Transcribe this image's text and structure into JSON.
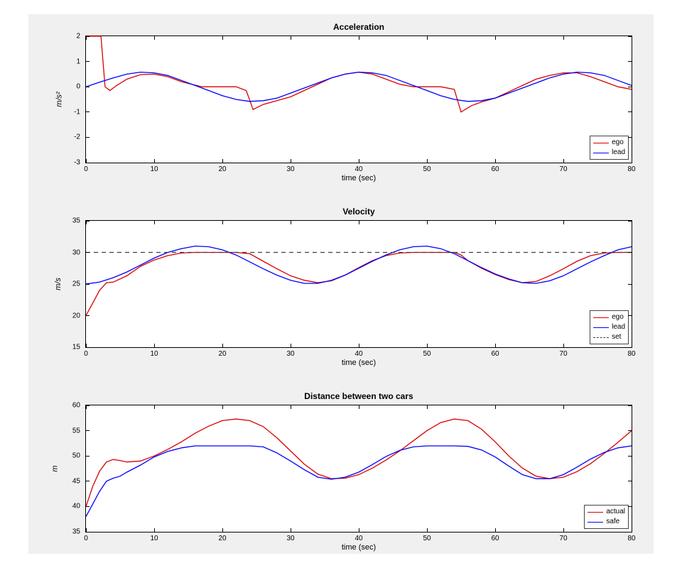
{
  "figure": {
    "bg": "#f0f0f0"
  },
  "colors": {
    "ego": "#d90000",
    "lead": "#0000ff",
    "set": "#404040",
    "actual": "#d90000",
    "safe": "#0000ff"
  },
  "chart_data": [
    {
      "id": "accel",
      "type": "line",
      "title": "Acceleration",
      "xlabel": "time (sec)",
      "ylabel": "m/s²",
      "xlim": [
        0,
        80
      ],
      "ylim": [
        -3,
        2
      ],
      "xticks": [
        0,
        10,
        20,
        30,
        40,
        50,
        60,
        70,
        80
      ],
      "yticks": [
        -3,
        -2,
        -1,
        0,
        1,
        2
      ],
      "legend_pos": "bottom-right",
      "series": [
        {
          "name": "ego",
          "color_key": "ego",
          "points": [
            [
              0,
              2
            ],
            [
              2.2,
              2
            ],
            [
              2.8,
              0
            ],
            [
              3.5,
              -0.15
            ],
            [
              4.5,
              0.05
            ],
            [
              6,
              0.3
            ],
            [
              8,
              0.48
            ],
            [
              10,
              0.5
            ],
            [
              12,
              0.4
            ],
            [
              14,
              0.2
            ],
            [
              17,
              0
            ],
            [
              20,
              0
            ],
            [
              22,
              0
            ],
            [
              23.5,
              -0.15
            ],
            [
              24.5,
              -0.9
            ],
            [
              26,
              -0.7
            ],
            [
              28,
              -0.55
            ],
            [
              30,
              -0.4
            ],
            [
              32,
              -0.15
            ],
            [
              34,
              0.1
            ],
            [
              36,
              0.35
            ],
            [
              38,
              0.5
            ],
            [
              40,
              0.58
            ],
            [
              42,
              0.5
            ],
            [
              44,
              0.3
            ],
            [
              46,
              0.1
            ],
            [
              48,
              0
            ],
            [
              50,
              0
            ],
            [
              52,
              0
            ],
            [
              54,
              -0.1
            ],
            [
              55,
              -1.0
            ],
            [
              56.5,
              -0.75
            ],
            [
              58,
              -0.6
            ],
            [
              60,
              -0.45
            ],
            [
              62,
              -0.2
            ],
            [
              64,
              0.05
            ],
            [
              66,
              0.3
            ],
            [
              68,
              0.45
            ],
            [
              70,
              0.55
            ],
            [
              72,
              0.55
            ],
            [
              74,
              0.4
            ],
            [
              76,
              0.2
            ],
            [
              78,
              0
            ],
            [
              80,
              -0.1
            ]
          ]
        },
        {
          "name": "lead",
          "color_key": "lead",
          "points": [
            [
              0,
              0
            ],
            [
              2,
              0.18
            ],
            [
              4,
              0.35
            ],
            [
              6,
              0.5
            ],
            [
              8,
              0.58
            ],
            [
              10,
              0.55
            ],
            [
              12,
              0.45
            ],
            [
              14,
              0.25
            ],
            [
              16,
              0.05
            ],
            [
              18,
              -0.15
            ],
            [
              20,
              -0.35
            ],
            [
              22,
              -0.5
            ],
            [
              24,
              -0.58
            ],
            [
              26,
              -0.55
            ],
            [
              28,
              -0.45
            ],
            [
              30,
              -0.25
            ],
            [
              32,
              -0.05
            ],
            [
              34,
              0.15
            ],
            [
              36,
              0.35
            ],
            [
              38,
              0.5
            ],
            [
              40,
              0.58
            ],
            [
              42,
              0.55
            ],
            [
              44,
              0.45
            ],
            [
              46,
              0.25
            ],
            [
              48,
              0.05
            ],
            [
              50,
              -0.15
            ],
            [
              52,
              -0.35
            ],
            [
              54,
              -0.5
            ],
            [
              56,
              -0.58
            ],
            [
              58,
              -0.55
            ],
            [
              60,
              -0.45
            ],
            [
              62,
              -0.25
            ],
            [
              64,
              -0.05
            ],
            [
              66,
              0.15
            ],
            [
              68,
              0.35
            ],
            [
              70,
              0.5
            ],
            [
              72,
              0.58
            ],
            [
              74,
              0.55
            ],
            [
              76,
              0.45
            ],
            [
              78,
              0.25
            ],
            [
              80,
              0.05
            ]
          ]
        }
      ]
    },
    {
      "id": "vel",
      "type": "line",
      "title": "Velocity",
      "xlabel": "time (sec)",
      "ylabel": "m/s",
      "xlim": [
        0,
        80
      ],
      "ylim": [
        15,
        35
      ],
      "xticks": [
        0,
        10,
        20,
        30,
        40,
        50,
        60,
        70,
        80
      ],
      "yticks": [
        15,
        20,
        25,
        30,
        35
      ],
      "legend_pos": "bottom-right",
      "series": [
        {
          "name": "ego",
          "color_key": "ego",
          "points": [
            [
              0,
              20
            ],
            [
              1,
              22
            ],
            [
              2,
              24
            ],
            [
              3,
              25.2
            ],
            [
              4,
              25.3
            ],
            [
              5,
              25.8
            ],
            [
              6,
              26.3
            ],
            [
              8,
              27.8
            ],
            [
              10,
              28.8
            ],
            [
              12,
              29.5
            ],
            [
              14,
              29.9
            ],
            [
              16,
              30
            ],
            [
              18,
              30
            ],
            [
              20,
              30
            ],
            [
              22,
              30
            ],
            [
              24,
              29.8
            ],
            [
              26,
              28.6
            ],
            [
              28,
              27.4
            ],
            [
              30,
              26.3
            ],
            [
              32,
              25.6
            ],
            [
              34,
              25.2
            ],
            [
              36,
              25.5
            ],
            [
              38,
              26.4
            ],
            [
              40,
              27.6
            ],
            [
              42,
              28.7
            ],
            [
              44,
              29.5
            ],
            [
              46,
              29.9
            ],
            [
              48,
              30
            ],
            [
              50,
              30
            ],
            [
              52,
              30
            ],
            [
              54,
              30
            ],
            [
              55,
              29.6
            ],
            [
              56,
              28.7
            ],
            [
              58,
              27.5
            ],
            [
              60,
              26.5
            ],
            [
              62,
              25.7
            ],
            [
              64,
              25.2
            ],
            [
              66,
              25.4
            ],
            [
              68,
              26.3
            ],
            [
              70,
              27.4
            ],
            [
              72,
              28.6
            ],
            [
              74,
              29.5
            ],
            [
              76,
              29.9
            ],
            [
              78,
              30
            ],
            [
              80,
              30
            ]
          ]
        },
        {
          "name": "lead",
          "color_key": "lead",
          "points": [
            [
              0,
              25
            ],
            [
              2,
              25.3
            ],
            [
              4,
              26
            ],
            [
              6,
              26.9
            ],
            [
              8,
              28
            ],
            [
              10,
              29.1
            ],
            [
              12,
              30
            ],
            [
              14,
              30.6
            ],
            [
              16,
              31
            ],
            [
              18,
              30.9
            ],
            [
              20,
              30.4
            ],
            [
              22,
              29.6
            ],
            [
              24,
              28.5
            ],
            [
              26,
              27.4
            ],
            [
              28,
              26.4
            ],
            [
              30,
              25.6
            ],
            [
              32,
              25.1
            ],
            [
              34,
              25.1
            ],
            [
              36,
              25.6
            ],
            [
              38,
              26.4
            ],
            [
              40,
              27.5
            ],
            [
              42,
              28.6
            ],
            [
              44,
              29.6
            ],
            [
              46,
              30.4
            ],
            [
              48,
              30.9
            ],
            [
              50,
              31
            ],
            [
              52,
              30.6
            ],
            [
              54,
              29.8
            ],
            [
              56,
              28.7
            ],
            [
              58,
              27.6
            ],
            [
              60,
              26.6
            ],
            [
              62,
              25.8
            ],
            [
              64,
              25.2
            ],
            [
              66,
              25.1
            ],
            [
              68,
              25.5
            ],
            [
              70,
              26.3
            ],
            [
              72,
              27.4
            ],
            [
              74,
              28.5
            ],
            [
              76,
              29.5
            ],
            [
              78,
              30.4
            ],
            [
              80,
              30.9
            ]
          ]
        },
        {
          "name": "set",
          "color_key": "set",
          "dashed": true,
          "points": [
            [
              0,
              30
            ],
            [
              80,
              30
            ]
          ]
        }
      ]
    },
    {
      "id": "dist",
      "type": "line",
      "title": "Distance between two cars",
      "xlabel": "time (sec)",
      "ylabel": "m",
      "xlim": [
        0,
        80
      ],
      "ylim": [
        35,
        60
      ],
      "xticks": [
        0,
        10,
        20,
        30,
        40,
        50,
        60,
        70,
        80
      ],
      "yticks": [
        35,
        40,
        45,
        50,
        55,
        60
      ],
      "legend_pos": "bottom-right",
      "series": [
        {
          "name": "actual",
          "color_key": "actual",
          "points": [
            [
              0,
              40
            ],
            [
              1,
              44
            ],
            [
              2,
              47
            ],
            [
              3,
              48.8
            ],
            [
              4,
              49.3
            ],
            [
              5,
              49.1
            ],
            [
              6,
              48.8
            ],
            [
              8,
              49
            ],
            [
              10,
              50
            ],
            [
              12,
              51.3
            ],
            [
              14,
              52.8
            ],
            [
              16,
              54.5
            ],
            [
              18,
              55.9
            ],
            [
              20,
              57
            ],
            [
              22,
              57.3
            ],
            [
              24,
              57
            ],
            [
              26,
              55.8
            ],
            [
              28,
              53.6
            ],
            [
              30,
              51
            ],
            [
              32,
              48.4
            ],
            [
              34,
              46.4
            ],
            [
              36,
              45.5
            ],
            [
              38,
              45.6
            ],
            [
              40,
              46.3
            ],
            [
              42,
              47.6
            ],
            [
              44,
              49.2
            ],
            [
              46,
              51
            ],
            [
              48,
              53
            ],
            [
              50,
              55
            ],
            [
              52,
              56.6
            ],
            [
              54,
              57.3
            ],
            [
              56,
              57
            ],
            [
              58,
              55.3
            ],
            [
              60,
              52.8
            ],
            [
              62,
              50
            ],
            [
              64,
              47.6
            ],
            [
              66,
              46
            ],
            [
              68,
              45.5
            ],
            [
              70,
              45.8
            ],
            [
              72,
              46.9
            ],
            [
              74,
              48.5
            ],
            [
              76,
              50.5
            ],
            [
              78,
              52.7
            ],
            [
              80,
              55
            ]
          ]
        },
        {
          "name": "safe",
          "color_key": "safe",
          "points": [
            [
              0,
              38
            ],
            [
              1,
              40.5
            ],
            [
              2,
              43
            ],
            [
              3,
              45
            ],
            [
              4,
              45.6
            ],
            [
              5,
              46
            ],
            [
              6,
              46.8
            ],
            [
              8,
              48.2
            ],
            [
              10,
              49.8
            ],
            [
              12,
              50.9
            ],
            [
              14,
              51.6
            ],
            [
              16,
              52
            ],
            [
              18,
              52
            ],
            [
              20,
              52
            ],
            [
              22,
              52
            ],
            [
              24,
              52
            ],
            [
              26,
              51.8
            ],
            [
              28,
              50.6
            ],
            [
              30,
              49
            ],
            [
              32,
              47.3
            ],
            [
              34,
              45.8
            ],
            [
              36,
              45.4
            ],
            [
              38,
              45.8
            ],
            [
              40,
              46.8
            ],
            [
              42,
              48.3
            ],
            [
              44,
              49.9
            ],
            [
              46,
              51.1
            ],
            [
              48,
              51.8
            ],
            [
              50,
              52
            ],
            [
              52,
              52
            ],
            [
              54,
              52
            ],
            [
              56,
              51.9
            ],
            [
              58,
              51.2
            ],
            [
              60,
              49.8
            ],
            [
              62,
              48
            ],
            [
              64,
              46.3
            ],
            [
              66,
              45.5
            ],
            [
              68,
              45.5
            ],
            [
              70,
              46.3
            ],
            [
              72,
              47.8
            ],
            [
              74,
              49.4
            ],
            [
              76,
              50.7
            ],
            [
              78,
              51.6
            ],
            [
              80,
              52
            ]
          ]
        }
      ]
    }
  ]
}
